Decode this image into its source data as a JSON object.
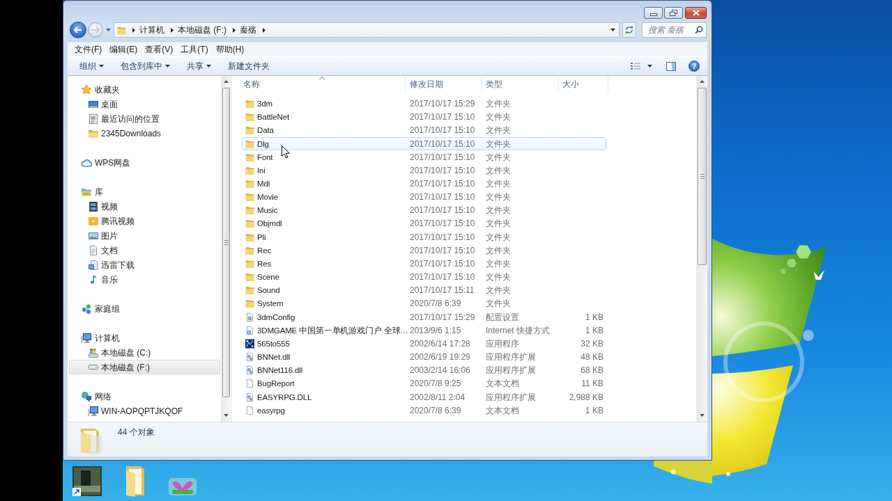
{
  "navigation": {
    "back": {
      "disabled": false
    },
    "forward": {
      "disabled": true
    }
  },
  "address_bar": {
    "crumbs": [
      "计算机",
      "本地磁盘 (F:)",
      "秦殇"
    ]
  },
  "search": {
    "placeholder": "搜索 秦殇"
  },
  "menu_bar": [
    "文件(F)",
    "编辑(E)",
    "查看(V)",
    "工具(T)",
    "帮助(H)"
  ],
  "toolbar": {
    "buttons": [
      {
        "label": "组织",
        "dropdown": true
      },
      {
        "label": "包含到库中",
        "dropdown": true
      },
      {
        "label": "共享",
        "dropdown": true
      },
      {
        "label": "新建文件夹",
        "dropdown": false
      }
    ],
    "help": "?"
  },
  "sidebar": {
    "groups": [
      {
        "label": "收藏夹",
        "kind": "favorites",
        "selected": false,
        "children": [
          {
            "label": "桌面",
            "kind": "desktop",
            "selected": false
          },
          {
            "label": "最近访问的位置",
            "kind": "recent",
            "selected": false
          },
          {
            "label": "2345Downloads",
            "kind": "folder",
            "selected": false
          }
        ]
      },
      {
        "label": "WPS网盘",
        "kind": "cloud",
        "selected": false
      },
      {
        "label": "库",
        "kind": "library",
        "selected": false,
        "children": [
          {
            "label": "视频",
            "kind": "video",
            "selected": false
          },
          {
            "label": "腾讯视频",
            "kind": "tencent-video",
            "selected": false
          },
          {
            "label": "图片",
            "kind": "pictures",
            "selected": false
          },
          {
            "label": "文档",
            "kind": "documents",
            "selected": false
          },
          {
            "label": "迅雷下载",
            "kind": "download",
            "selected": false
          },
          {
            "label": "音乐",
            "kind": "music",
            "selected": false
          }
        ]
      },
      {
        "label": "家庭组",
        "kind": "homegroup",
        "selected": false
      },
      {
        "label": "计算机",
        "kind": "computer",
        "selected": false,
        "children": [
          {
            "label": "本地磁盘 (C:)",
            "kind": "system-drive",
            "selected": false
          },
          {
            "label": "本地磁盘 (F:)",
            "kind": "drive",
            "selected": true
          }
        ]
      },
      {
        "label": "网络",
        "kind": "network",
        "selected": false,
        "children": [
          {
            "label": "WIN-AOPQPTJKQOF",
            "kind": "pc",
            "selected": false
          }
        ]
      }
    ]
  },
  "file_list": {
    "columns": [
      {
        "label": "名称",
        "sorted": true
      },
      {
        "label": "修改日期",
        "sorted": false
      },
      {
        "label": "类型",
        "sorted": false
      },
      {
        "label": "大小",
        "sorted": false
      }
    ],
    "rows": [
      {
        "name": "3dm",
        "date": "2017/10/17 15:29",
        "type": "文件夹",
        "kind": "folder",
        "hovered": false
      },
      {
        "name": "BattleNet",
        "date": "2017/10/17 15:10",
        "type": "文件夹",
        "kind": "folder",
        "hovered": false
      },
      {
        "name": "Data",
        "date": "2017/10/17 15:10",
        "type": "文件夹",
        "kind": "folder",
        "hovered": false
      },
      {
        "name": "Dlg",
        "date": "2017/10/17 15:10",
        "type": "文件夹",
        "kind": "folder",
        "hovered": true
      },
      {
        "name": "Font",
        "date": "2017/10/17 15:10",
        "type": "文件夹",
        "kind": "folder",
        "hovered": false
      },
      {
        "name": "Ini",
        "date": "2017/10/17 15:10",
        "type": "文件夹",
        "kind": "folder",
        "hovered": false
      },
      {
        "name": "Mdl",
        "date": "2017/10/17 15:10",
        "type": "文件夹",
        "kind": "folder",
        "hovered": false
      },
      {
        "name": "Movie",
        "date": "2017/10/17 15:10",
        "type": "文件夹",
        "kind": "folder",
        "hovered": false
      },
      {
        "name": "Music",
        "date": "2017/10/17 15:10",
        "type": "文件夹",
        "kind": "folder",
        "hovered": false
      },
      {
        "name": "Objmdl",
        "date": "2017/10/17 15:10",
        "type": "文件夹",
        "kind": "folder",
        "hovered": false
      },
      {
        "name": "Pli",
        "date": "2017/10/17 15:10",
        "type": "文件夹",
        "kind": "folder",
        "hovered": false
      },
      {
        "name": "Rec",
        "date": "2017/10/17 15:10",
        "type": "文件夹",
        "kind": "folder",
        "hovered": false
      },
      {
        "name": "Res",
        "date": "2017/10/17 15:10",
        "type": "文件夹",
        "kind": "folder",
        "hovered": false
      },
      {
        "name": "Scene",
        "date": "2017/10/17 15:10",
        "type": "文件夹",
        "kind": "folder",
        "hovered": false
      },
      {
        "name": "Sound",
        "date": "2017/10/17 15:11",
        "type": "文件夹",
        "kind": "folder",
        "hovered": false
      },
      {
        "name": "System",
        "date": "2020/7/8 6:39",
        "type": "文件夹",
        "kind": "folder",
        "hovered": false
      },
      {
        "name": "3dmConfig",
        "date": "2017/10/17 15:29",
        "type": "配置设置",
        "size": "1 KB",
        "kind": "config",
        "hovered": false
      },
      {
        "name": "3DMGAME 中国第一单机游戏门户 全球…",
        "date": "2013/9/6 1:15",
        "type": "Internet 快捷方式",
        "size": "1 KB",
        "kind": "shortcut",
        "hovered": false
      },
      {
        "name": "565to555",
        "date": "2002/6/14 17:28",
        "type": "应用程序",
        "size": "32 KB",
        "kind": "app",
        "hovered": false
      },
      {
        "name": "BNNet.dll",
        "date": "2002/6/19 19:29",
        "type": "应用程序扩展",
        "size": "48 KB",
        "kind": "dll",
        "hovered": false
      },
      {
        "name": "BNNet116.dll",
        "date": "2003/2/14 16:06",
        "type": "应用程序扩展",
        "size": "68 KB",
        "kind": "dll",
        "hovered": false
      },
      {
        "name": "BugReport",
        "date": "2020/7/8 9:25",
        "type": "文本文档",
        "size": "11 KB",
        "kind": "text",
        "hovered": false
      },
      {
        "name": "EASYRPG.DLL",
        "date": "2002/8/11 2:04",
        "type": "应用程序扩展",
        "size": "2,988 KB",
        "kind": "dll",
        "hovered": false
      },
      {
        "name": "easyrpg",
        "date": "2020/7/8 6:39",
        "type": "文本文档",
        "size": "1 KB",
        "kind": "text",
        "hovered": false
      }
    ]
  },
  "status_bar": {
    "count": "44 个对象"
  }
}
